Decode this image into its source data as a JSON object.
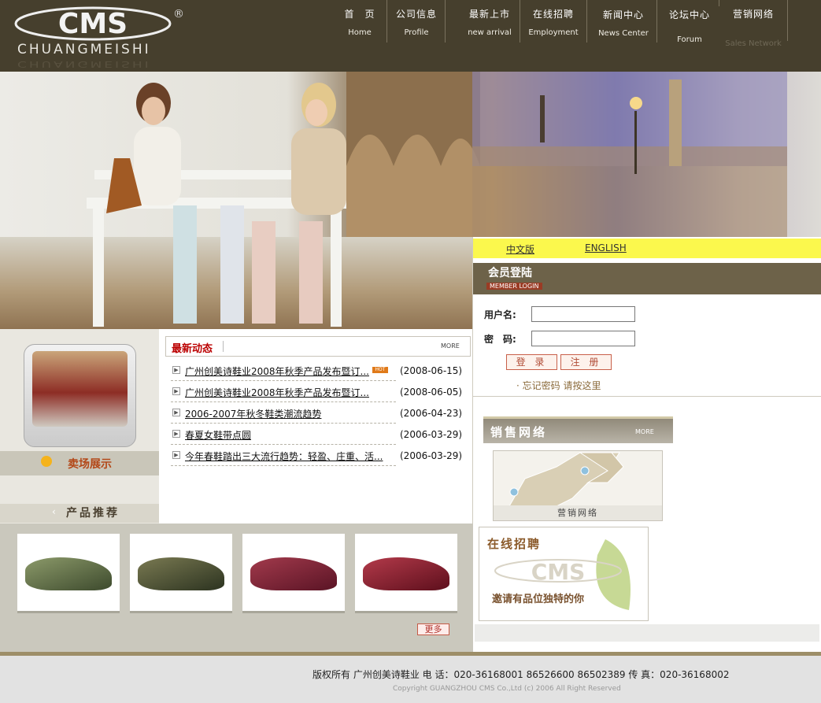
{
  "brand": {
    "logo_text": "CMS",
    "registered": "®",
    "name": "CHUANGMEISHI"
  },
  "nav": [
    {
      "cn": "首　页",
      "en": "Home"
    },
    {
      "cn": "公司信息",
      "en": "Profile"
    },
    {
      "cn": "最新上市",
      "en": "new arrival"
    },
    {
      "cn": "在线招聘",
      "en": "Employment"
    },
    {
      "cn": "新闻中心",
      "en": "News Center"
    },
    {
      "cn": "论坛中心",
      "en": "Forum"
    },
    {
      "cn": "营销网络",
      "en": "Sales Network"
    }
  ],
  "lang": {
    "cn": "中文版",
    "en": "ENGLISH"
  },
  "member": {
    "title": "会员登陆",
    "subtitle": "MEMBER LOGIN",
    "username_label": "用户名:",
    "password_label": "密　码:",
    "login_btn": "登 录",
    "register_btn": "注 册",
    "forgot": "· 忘记密码 请按这里"
  },
  "sales": {
    "title": "销售网络",
    "more": "MORE",
    "map_caption": "营销网络"
  },
  "jobs": {
    "title": "在线招聘",
    "slogan": "邀请有品位独特的你"
  },
  "showroom": {
    "label": "卖场展示"
  },
  "products": {
    "label": "产品推荐",
    "more": "更多"
  },
  "news": {
    "title": "最新动态",
    "more": "MORE",
    "hot": "HOT",
    "items": [
      {
        "title": "广州创美诗鞋业2008年秋季产品发布暨订...",
        "date": "(2008-06-15)"
      },
      {
        "title": "广州创美诗鞋业2008年秋季产品发布暨订...",
        "date": "(2008-06-05)"
      },
      {
        "title": "2006-2007年秋冬鞋类潮流趋势",
        "date": "(2006-04-23)"
      },
      {
        "title": "春夏女鞋带点圆",
        "date": "(2006-03-29)"
      },
      {
        "title": "今年春鞋踏出三大流行趋势：轻盈、庄重、活...",
        "date": "(2006-03-29)"
      }
    ]
  },
  "footer": {
    "copyright": "版权所有  广州创美诗鞋业     电 话：020-36168001    86526600    86502389     传 真：020-36168002",
    "english": "Copyright GUANGZHOU CMS Co.,Ltd (c) 2006 All Right Reserved"
  },
  "colors": {
    "header": "#463f2d",
    "lang_bar": "#fbf84d",
    "member_bar": "#6d6249",
    "accent_red": "#b00000"
  }
}
